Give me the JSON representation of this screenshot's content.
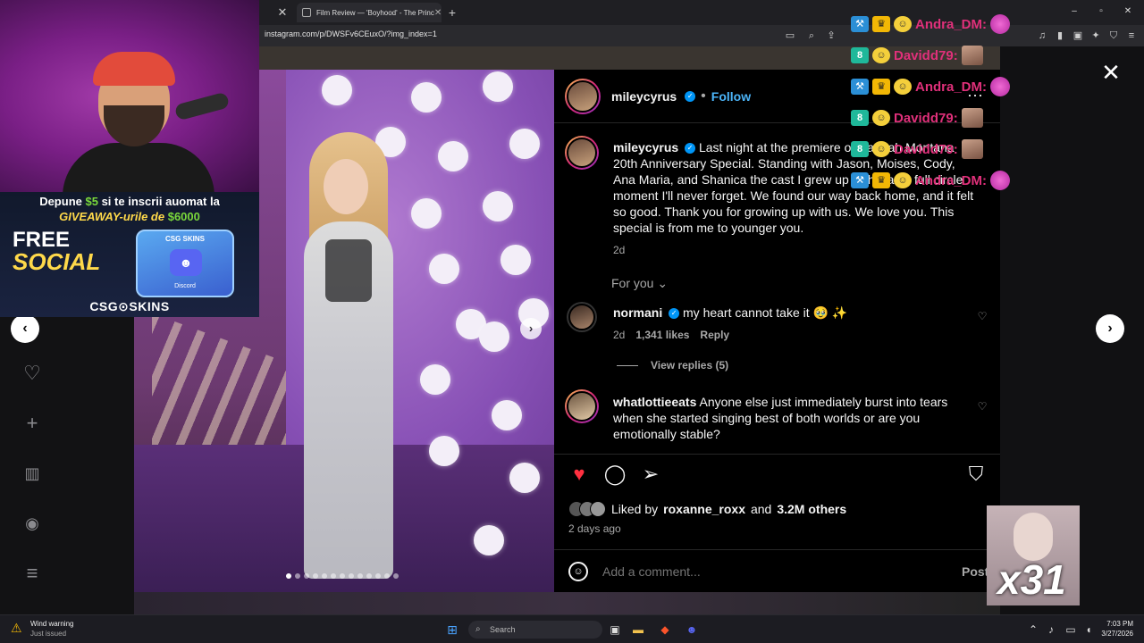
{
  "browser": {
    "tab_title": "Film Review — 'Boyhood' - The Princ",
    "new_tab": "+",
    "url": "instagram.com/p/DWSFv6CEuxO/?img_index=1",
    "window_controls": [
      "–",
      "▫",
      "✕"
    ]
  },
  "post": {
    "author": "mileycyrus",
    "follow_label": "Follow",
    "caption_author": "mileycyrus",
    "caption_text": "Last night at the premiere of Hannah Montana 20th Anniversary Special. Standing with Jason, Moises, Cody, Ana Maria, and Shanica the cast I grew up with was a full circle moment I'll never forget. We found our way back home, and it felt so good. Thank you for growing up with us. We love you. This special is from me to younger you.",
    "caption_time": "2d",
    "sort_label": "For you",
    "comments": [
      {
        "user": "normani",
        "verified": true,
        "text": "my heart cannot take it 🥹 ✨",
        "time": "2d",
        "likes": "1,341 likes",
        "reply": "Reply",
        "view_replies": "View replies (5)"
      },
      {
        "user": "whatlottieeats",
        "verified": false,
        "text": "Anyone else just immediately burst into tears when she started singing best of both worlds or are you emotionally stable?"
      }
    ],
    "liked_by_prefix": "Liked by",
    "liked_by_user": "roxanne_roxx",
    "liked_by_and": "and",
    "liked_by_count": "3.2M others",
    "posted_ago": "2 days ago",
    "comment_placeholder": "Add a comment...",
    "post_button": "Post",
    "carousel_total": 13,
    "carousel_index": 1
  },
  "stream_overlay": {
    "promo_line1_a": "Depune",
    "promo_amount1": "$5",
    "promo_line1_b": "si te inscrii auomat la",
    "promo_line2_a": "GIVEAWAY-urile de",
    "promo_amount2": "$6000",
    "free": "FREE",
    "social": "SOCIAL",
    "box_brand": "CSG SKINS",
    "box_label": "Discord",
    "sponsor": "CSG⊙SKINS",
    "chat": [
      {
        "name": "Andra_DM:",
        "color": "#e0307a"
      },
      {
        "name": "Davidd79:",
        "color": "#e0307a"
      },
      {
        "name": "Andra_DM:",
        "color": "#e0307a"
      },
      {
        "name": "Davidd79:",
        "color": "#e0307a"
      },
      {
        "name": "Davidd79:",
        "color": "#e0307a"
      },
      {
        "name": "Andra_DM:",
        "color": "#e0307a"
      }
    ],
    "combo": "x31"
  },
  "taskbar": {
    "weather_title": "Wind warning",
    "weather_sub": "Just issued",
    "search": "Search",
    "time": "7:03 PM",
    "date": "3/27/2026"
  },
  "colors": {
    "accent": "#0095f6",
    "like": "#ff3040",
    "follow": "#4cb5f9"
  }
}
